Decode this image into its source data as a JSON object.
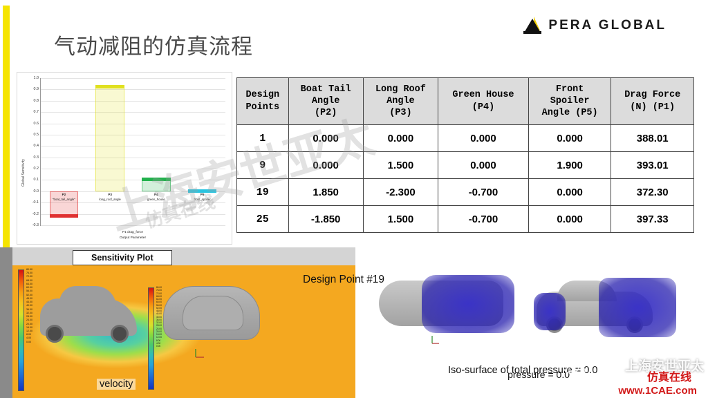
{
  "header": {
    "title": "气动减阻的仿真流程",
    "logo_text": "PERA GLOBAL",
    "logo_icon": "pera-triangle-mark"
  },
  "table": {
    "headers": [
      "Design\nPoints",
      "Boat Tail\nAngle\n(P2)",
      "Long Roof\nAngle\n(P3)",
      "Green House\n(P4)",
      "Front\nSpoiler\nAngle (P5)",
      "Drag Force\n(N) (P1)"
    ],
    "rows": [
      [
        "1",
        "0.000",
        "0.000",
        "0.000",
        "0.000",
        "388.01"
      ],
      [
        "9",
        "0.000",
        "1.500",
        "0.000",
        "1.900",
        "393.01"
      ],
      [
        "19",
        "1.850",
        "-2.300",
        "-0.700",
        "0.000",
        "372.30"
      ],
      [
        "25",
        "-1.850",
        "1.500",
        "-0.700",
        "0.000",
        "397.33"
      ]
    ]
  },
  "chart_data": {
    "type": "bar",
    "title": "",
    "xlabel": "P1 drag_force\nOutput Parameter",
    "ylabel": "Global Sensitivity",
    "ylim": [
      -0.3,
      1.0
    ],
    "ytick_step": 0.1,
    "grid": true,
    "categories": [
      "P2",
      "P3",
      "P4",
      "P5"
    ],
    "category_sublabels": [
      "\"boat_tail_angle\"",
      "long_roof_angle",
      "green_house",
      "front_spoiler"
    ],
    "values": [
      -0.23,
      0.94,
      0.12,
      0.015
    ],
    "colors": [
      "#e03131",
      "#e0e020",
      "#22b14c",
      "#29c4e0"
    ],
    "yticks": [
      "1.0",
      "0.9",
      "0.8",
      "0.7",
      "0.6",
      "0.5",
      "0.4",
      "0.3",
      "0.2",
      "0.1",
      "0.0",
      "-0.1",
      "-0.2",
      "-0.3"
    ]
  },
  "bottom": {
    "sensitivity_badge": "Sensitivity Plot",
    "caption_velocity": "velocity",
    "caption_design_point": "Design Point #19",
    "caption_iso": "Iso-surface of total pressure = 0.0",
    "caption_pressure_partial": "pressure = 0.0",
    "colorbar_ticks": [
      "80.00",
      "76.00",
      "72.00",
      "68.00",
      "64.00",
      "60.00",
      "56.00",
      "52.00",
      "48.00",
      "44.00",
      "40.00",
      "36.00",
      "32.00",
      "28.00",
      "24.00",
      "20.00",
      "16.00",
      "12.00",
      "8.00",
      "4.00",
      "0.00"
    ]
  },
  "watermarks": {
    "main": "上海安世亚太",
    "site": "仿真在线",
    "corner_text": "上海安世亚太",
    "red_text": "仿真在线",
    "url": "www.1CAE.com",
    "wechat_icon": "wechat-icon"
  }
}
